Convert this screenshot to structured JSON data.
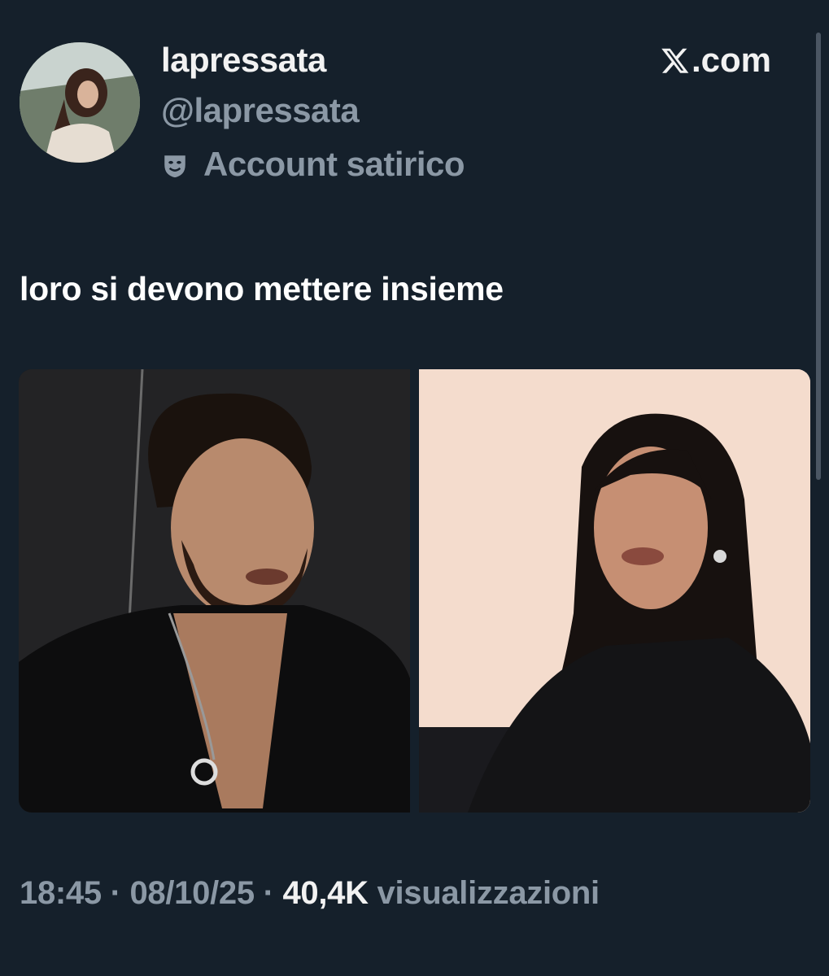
{
  "author": {
    "display_name": "lapressata",
    "handle": "@lapressata",
    "label": "Account satirico",
    "label_icon": "theater-mask-icon",
    "avatar": "profile-avatar"
  },
  "brand": {
    "name": ".com",
    "icon": "x-logo-icon"
  },
  "tweet": {
    "text": "loro si devono mettere insieme",
    "media": [
      {
        "name": "photo-man",
        "description_icon": "photo"
      },
      {
        "name": "photo-woman",
        "description_icon": "photo"
      }
    ]
  },
  "meta": {
    "time": "18:45",
    "date": "08/10/25",
    "views_count": "40,4K",
    "views_label": "visualizzazioni",
    "separator": " · "
  },
  "colors": {
    "background": "#15202b",
    "primary_text": "#f2f2f2",
    "secondary_text": "#8b98a5"
  }
}
